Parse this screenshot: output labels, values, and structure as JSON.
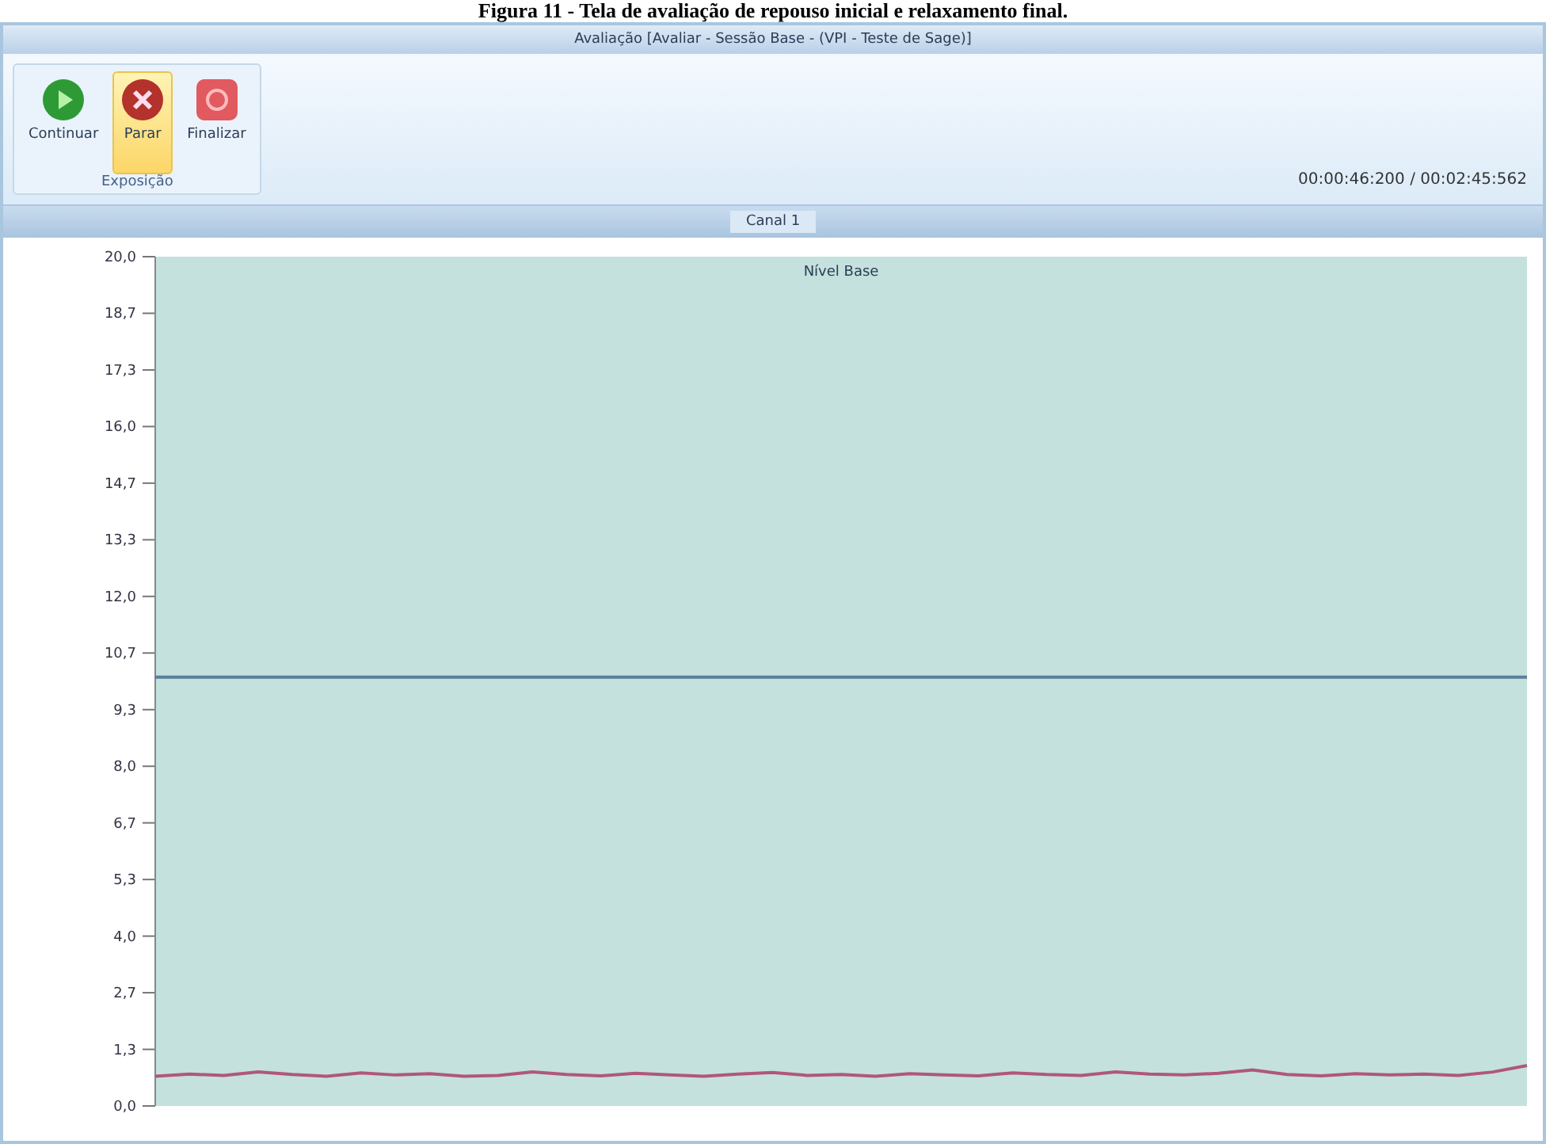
{
  "caption": "Figura 11 - Tela de avaliação de repouso inicial e relaxamento final.",
  "window": {
    "title": "Avaliação [Avaliar - Sessão Base - (VPI - Teste de Sage)]"
  },
  "toolbar": {
    "buttons": [
      {
        "label": "Continuar",
        "kind": "play",
        "selected": false
      },
      {
        "label": "Parar",
        "kind": "stop",
        "selected": true
      },
      {
        "label": "Finalizar",
        "kind": "finish",
        "selected": false
      }
    ],
    "group": "Exposição",
    "time": "00:00:46:200 / 00:02:45:562"
  },
  "tabs": [
    {
      "label": "Canal 1",
      "selected": true
    }
  ],
  "chart": {
    "chart_data": {
      "type": "line",
      "title": "Nível Base",
      "ylim": [
        0,
        20
      ],
      "yticks": [
        {
          "value": 0,
          "label": "0,0"
        },
        {
          "value": 1.333,
          "label": "1,3"
        },
        {
          "value": 2.667,
          "label": "2,7"
        },
        {
          "value": 4,
          "label": "4,0"
        },
        {
          "value": 5.333,
          "label": "5,3"
        },
        {
          "value": 6.667,
          "label": "6,7"
        },
        {
          "value": 8,
          "label": "8,0"
        },
        {
          "value": 9.333,
          "label": "9,3"
        },
        {
          "value": 10.667,
          "label": "10,7"
        },
        {
          "value": 12,
          "label": "12,0"
        },
        {
          "value": 13.333,
          "label": "13,3"
        },
        {
          "value": 14.667,
          "label": "14,7"
        },
        {
          "value": 16,
          "label": "16,0"
        },
        {
          "value": 17.333,
          "label": "17,3"
        },
        {
          "value": 18.667,
          "label": "18,7"
        },
        {
          "value": 20,
          "label": "20,0"
        }
      ],
      "series": [
        {
          "color": "#5a7f9a",
          "values": [
            10.1,
            10.1,
            10.1,
            10.1,
            10.1,
            10.1,
            10.1,
            10.1,
            10.1,
            10.1,
            10.1,
            10.1,
            10.1,
            10.1,
            10.1,
            10.1,
            10.1,
            10.1,
            10.1,
            10.1,
            10.1,
            10.1,
            10.1,
            10.1,
            10.1,
            10.1,
            10.1,
            10.1,
            10.1,
            10.1,
            10.1,
            10.1,
            10.1,
            10.1,
            10.1,
            10.1,
            10.1,
            10.1,
            10.1,
            10.1,
            10.1
          ]
        },
        {
          "color": "#b0577a",
          "values": [
            0.7,
            0.75,
            0.72,
            0.8,
            0.74,
            0.7,
            0.78,
            0.73,
            0.76,
            0.7,
            0.72,
            0.8,
            0.74,
            0.71,
            0.77,
            0.73,
            0.7,
            0.75,
            0.79,
            0.72,
            0.74,
            0.7,
            0.76,
            0.73,
            0.71,
            0.78,
            0.74,
            0.72,
            0.8,
            0.75,
            0.73,
            0.77,
            0.85,
            0.74,
            0.71,
            0.76,
            0.73,
            0.75,
            0.72,
            0.8,
            0.95
          ]
        }
      ]
    }
  }
}
